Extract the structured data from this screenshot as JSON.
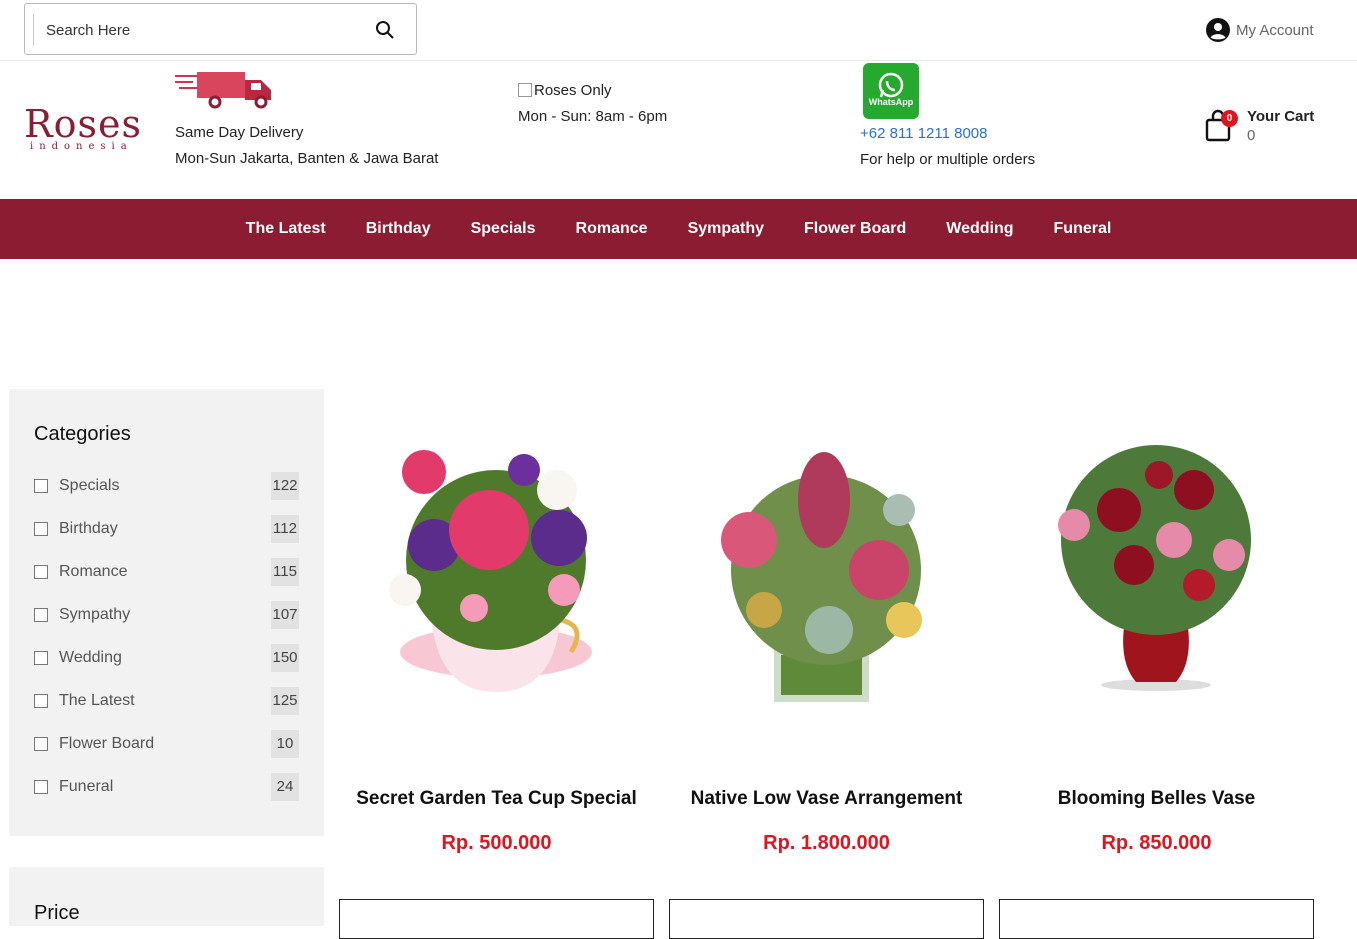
{
  "topbar": {
    "search_placeholder": "Search Here",
    "account_label": "My Account"
  },
  "header": {
    "logo_text": "Roses",
    "logo_sub": "indonesia",
    "delivery_line1": "Same Day Delivery",
    "delivery_line2": "Mon-Sun Jakarta, Banten & Jawa Barat",
    "hours_alt": "Roses Only",
    "hours_text": "Mon - Sun: 8am - 6pm",
    "whatsapp_label": "WhatsApp",
    "whatsapp_phone": "+62 811 1211 8008",
    "whatsapp_note": "For help or multiple orders",
    "cart_label": "Your Cart",
    "cart_count": "0",
    "cart_badge": "0"
  },
  "nav": [
    "The Latest",
    "Birthday",
    "Specials",
    "Romance",
    "Sympathy",
    "Flower Board",
    "Wedding",
    "Funeral"
  ],
  "sidebar": {
    "categories_title": "Categories",
    "categories": [
      {
        "label": "Specials",
        "count": "122"
      },
      {
        "label": "Birthday",
        "count": "112"
      },
      {
        "label": "Romance",
        "count": "115"
      },
      {
        "label": "Sympathy",
        "count": "107"
      },
      {
        "label": "Wedding",
        "count": "150"
      },
      {
        "label": "The Latest",
        "count": "125"
      },
      {
        "label": "Flower Board",
        "count": "10"
      },
      {
        "label": "Funeral",
        "count": "24"
      }
    ],
    "price_title": "Price"
  },
  "products": [
    {
      "name": "Secret Garden Tea Cup Special",
      "price": "Rp. 500.000"
    },
    {
      "name": "Native Low Vase Arrangement",
      "price": "Rp. 1.800.000"
    },
    {
      "name": "Blooming Belles Vase",
      "price": "Rp. 850.000"
    }
  ],
  "colors": {
    "brand": "#8b1c32",
    "price": "#e0141e",
    "whatsapp": "#25a92e",
    "link": "#2a6fd6"
  }
}
